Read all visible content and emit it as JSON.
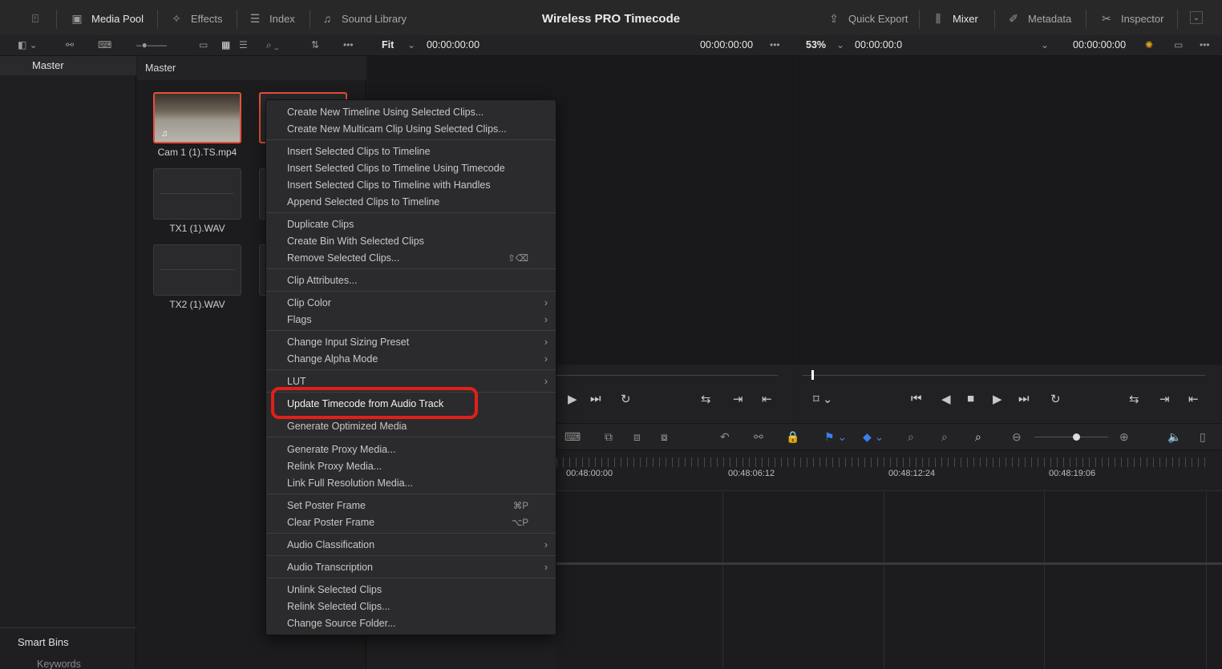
{
  "topbar": {
    "media_pool": "Media Pool",
    "effects": "Effects",
    "index": "Index",
    "sound_library": "Sound Library",
    "title": "Wireless PRO Timecode",
    "quick_export": "Quick Export",
    "mixer": "Mixer",
    "metadata": "Metadata",
    "inspector": "Inspector"
  },
  "toolbar2": {
    "fit": "Fit",
    "src_tc_start": "00:00:00:00",
    "src_tc_end": "00:00:00:00",
    "zoom": "53%",
    "tl_tc_start": "00:00:00:0",
    "tl_tc_end": "00:00:00:00"
  },
  "bins": {
    "master": "Master",
    "smart_bins": "Smart Bins",
    "keywords": "Keywords"
  },
  "pool": {
    "header": "Master",
    "clips": [
      {
        "name": "Cam 1 (1).TS.mp4"
      },
      {
        "name": "TX1 (1).WAV"
      },
      {
        "name": "TX2 (1).WAV"
      }
    ]
  },
  "timeline": {
    "ticks": [
      "00:48:00:00",
      "00:48:06:12",
      "00:48:12:24",
      "00:48:19:06"
    ]
  },
  "menu": {
    "items": [
      {
        "label": "Create New Timeline Using Selected Clips..."
      },
      {
        "label": "Create New Multicam Clip Using Selected Clips..."
      },
      {
        "label": "Insert Selected Clips to Timeline"
      },
      {
        "label": "Insert Selected Clips to Timeline Using Timecode"
      },
      {
        "label": "Insert Selected Clips to Timeline with Handles"
      },
      {
        "label": "Append Selected Clips to Timeline"
      },
      {
        "label": "Duplicate Clips"
      },
      {
        "label": "Create Bin With Selected Clips"
      },
      {
        "label": "Remove Selected Clips...",
        "shortcut": "⇧⌫"
      },
      {
        "label": "Clip Attributes..."
      },
      {
        "label": "Clip Color"
      },
      {
        "label": "Flags"
      },
      {
        "label": "Change Input Sizing Preset"
      },
      {
        "label": "Change Alpha Mode"
      },
      {
        "label": "LUT"
      },
      {
        "label": "Update Timecode from Audio Track"
      },
      {
        "label": "Generate Optimized Media"
      },
      {
        "label": "Generate Proxy Media..."
      },
      {
        "label": "Relink Proxy Media..."
      },
      {
        "label": "Link Full Resolution Media..."
      },
      {
        "label": "Set Poster Frame",
        "shortcut": "⌘P"
      },
      {
        "label": "Clear Poster Frame",
        "shortcut": "⌥P"
      },
      {
        "label": "Audio Classification"
      },
      {
        "label": "Audio Transcription"
      },
      {
        "label": "Unlink Selected Clips"
      },
      {
        "label": "Relink Selected Clips..."
      },
      {
        "label": "Change Source Folder..."
      }
    ]
  },
  "colors": {
    "highlight_box": "#e0201a",
    "selected_clip_border": "#e8503a",
    "blue_flag": "#3b7ff0"
  }
}
